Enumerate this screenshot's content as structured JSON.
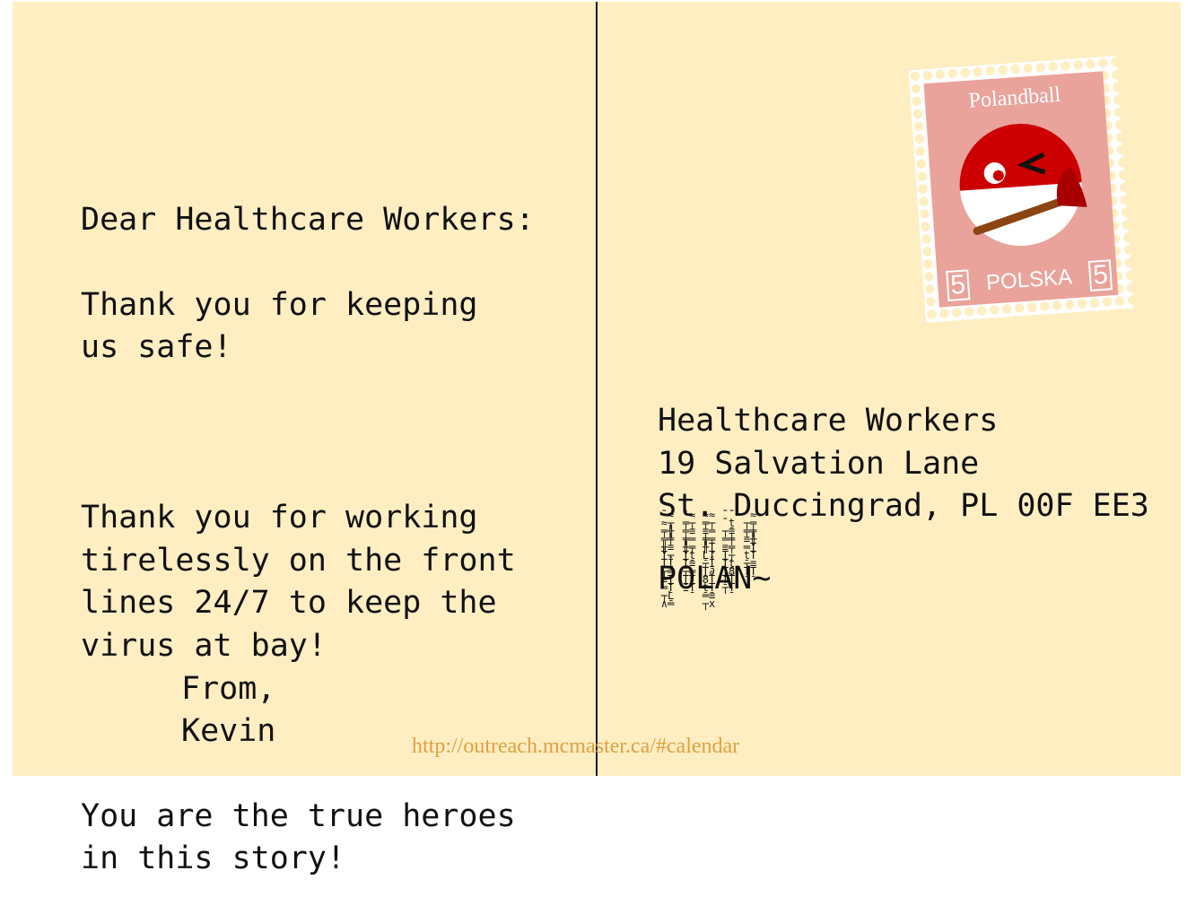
{
  "message": {
    "greeting": "Dear Healthcare Workers:",
    "paragraph1": "Thank you for keeping\nus safe!",
    "paragraph2": "Thank you for working\ntirelessly on the front\nlines 24/7 to keep the\nvirus at bay!",
    "paragraph3": "You are the true heroes\nin this story!",
    "signoff": "From,",
    "sender": "Kevin"
  },
  "address": {
    "recipient": "Healthcare Workers",
    "street": "19 Salvation Lane",
    "city_line": "St. Duccingrad, PL 00F EE3",
    "country": "POLAN~"
  },
  "stamp": {
    "title": "Polandball",
    "value_left": "5",
    "value_right": "5",
    "country": "POLSKA",
    "colors": {
      "background": "#e9a39b",
      "red": "#cc0000",
      "white": "#ffffff",
      "plunger_handle": "#8b4513",
      "plunger_cup": "#a80000"
    }
  },
  "zalgo_columns": [
    "˜≈≈┬╤╫═╪╫≡Ṫ┬ṪĪ┬═≡Ṯ═Ṯ┬Ḻ∧═",
    "ˆ≈╤┬═≡╪═╫╤ṮṯṮ≡┬═ṮṮΞṮ",
    "≈≈╤┬≡═╪╤╫ƮḺṪ┬ĪṮ∂8ṪṯṮ═≡┬x",
    "˜˜˜ṯ┬≡═╪≡╤Ṯ┬ṮṯṮ8ṮṪ┬Ṯ",
    "ˆ≈┬═╤╪≡╫═ṮṯṪ┬≡ṮṮ"
  ],
  "footer_url": "http://outreach.mcmaster.ca/#calendar",
  "colors": {
    "card": "#feeec2",
    "text": "#111111",
    "url": "#e0a040",
    "divider": "#1a1a1a"
  }
}
